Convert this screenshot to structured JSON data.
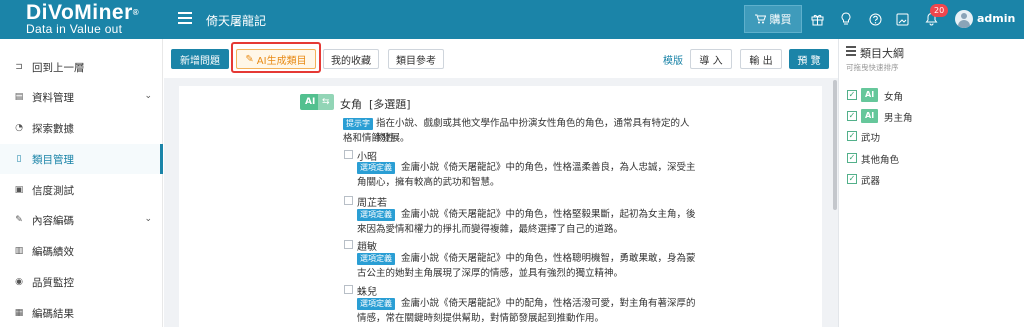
{
  "header": {
    "logo_main": "DiVoMiner",
    "logo_reg": "®",
    "logo_sub": "Data in  Value out",
    "project_title": "倚天屠龍記",
    "buy_label": "購買",
    "notification_count": "20",
    "username": "admin",
    "icons": [
      "menu-icon",
      "cart-icon",
      "gift-icon",
      "bulb-icon",
      "help-icon",
      "image-icon",
      "bell-icon",
      "avatar"
    ]
  },
  "sidebar": {
    "items": [
      {
        "label": "回到上一層",
        "icon": "back-icon",
        "has_chevron": false
      },
      {
        "label": "資料管理",
        "icon": "document-icon",
        "has_chevron": true
      },
      {
        "label": "探索數據",
        "icon": "dashboard-icon",
        "has_chevron": false
      },
      {
        "label": "類目管理",
        "icon": "file-icon",
        "has_chevron": false,
        "active": true
      },
      {
        "label": "信度測試",
        "icon": "test-icon",
        "has_chevron": false
      },
      {
        "label": "內容編碼",
        "icon": "pencil-icon",
        "has_chevron": true
      },
      {
        "label": "編碼績效",
        "icon": "chart-icon",
        "has_chevron": false
      },
      {
        "label": "品質監控",
        "icon": "eye-icon",
        "has_chevron": false
      },
      {
        "label": "編碼結果",
        "icon": "table-icon",
        "has_chevron": false
      }
    ]
  },
  "toolbar": {
    "new_question": "新增問題",
    "ai_generate": "AI生成類目",
    "ai_icon": "✎",
    "my_favorites": "我的收藏",
    "category_ref": "類目參考",
    "template": "模版",
    "import": "導 入",
    "export": "輸 出",
    "preview": "預 覽"
  },
  "question": {
    "ai_tag": "AI",
    "ai_tag_icon": "⇆",
    "title": "女角",
    "type": "[多選題]",
    "hint_tag": "提示字",
    "hint_line1": "指在小說、戲劇或其他文學作品中扮演女性角色的角色，通常具有特定的人物性",
    "hint_line2": "格和情節發展。",
    "options": [
      {
        "label": "小昭",
        "tag": "選項定義",
        "line1": "金庸小說《倚天屠龍記》中的角色，性格溫柔善良，為人忠誠，深受主",
        "line2": "角關心，擁有較高的武功和智慧。"
      },
      {
        "label": "周芷若",
        "tag": "選項定義",
        "line1": "金庸小說《倚天屠龍記》中的角色，性格堅毅果斷，起初為女主角，後",
        "line2": "來因為愛情和權力的掙扎而變得複雜，最終選擇了自己的道路。"
      },
      {
        "label": "趙敏",
        "tag": "選項定義",
        "line1": "金庸小說《倚天屠龍記》中的角色，性格聰明機智，勇敢果敢，身為蒙",
        "line2": "古公主的她對主角展現了深厚的情感，並具有強烈的獨立精神。"
      },
      {
        "label": "蛛兒",
        "tag": "選項定義",
        "line1": "金庸小說《倚天屠龍記》中的配角，性格活潑可愛，對主角有著深厚的",
        "line2": "情感，常在關鍵時刻提供幫助，對情節發展起到推動作用。"
      }
    ]
  },
  "outline": {
    "title": "類目大綱",
    "subtitle": "可拖曳快速排序",
    "items": [
      {
        "label": "女角",
        "ai": true
      },
      {
        "label": "男主角",
        "ai": true
      },
      {
        "label": "武功",
        "ai": false
      },
      {
        "label": "其他角色",
        "ai": false
      },
      {
        "label": "武器",
        "ai": false
      }
    ],
    "ai_label": "AI",
    "check_mark": "✓"
  },
  "colors": {
    "brand": "#1b84a8",
    "ai_green": "#52c08f",
    "highlight_red": "#e53935",
    "ai_orange": "#e88b16"
  }
}
